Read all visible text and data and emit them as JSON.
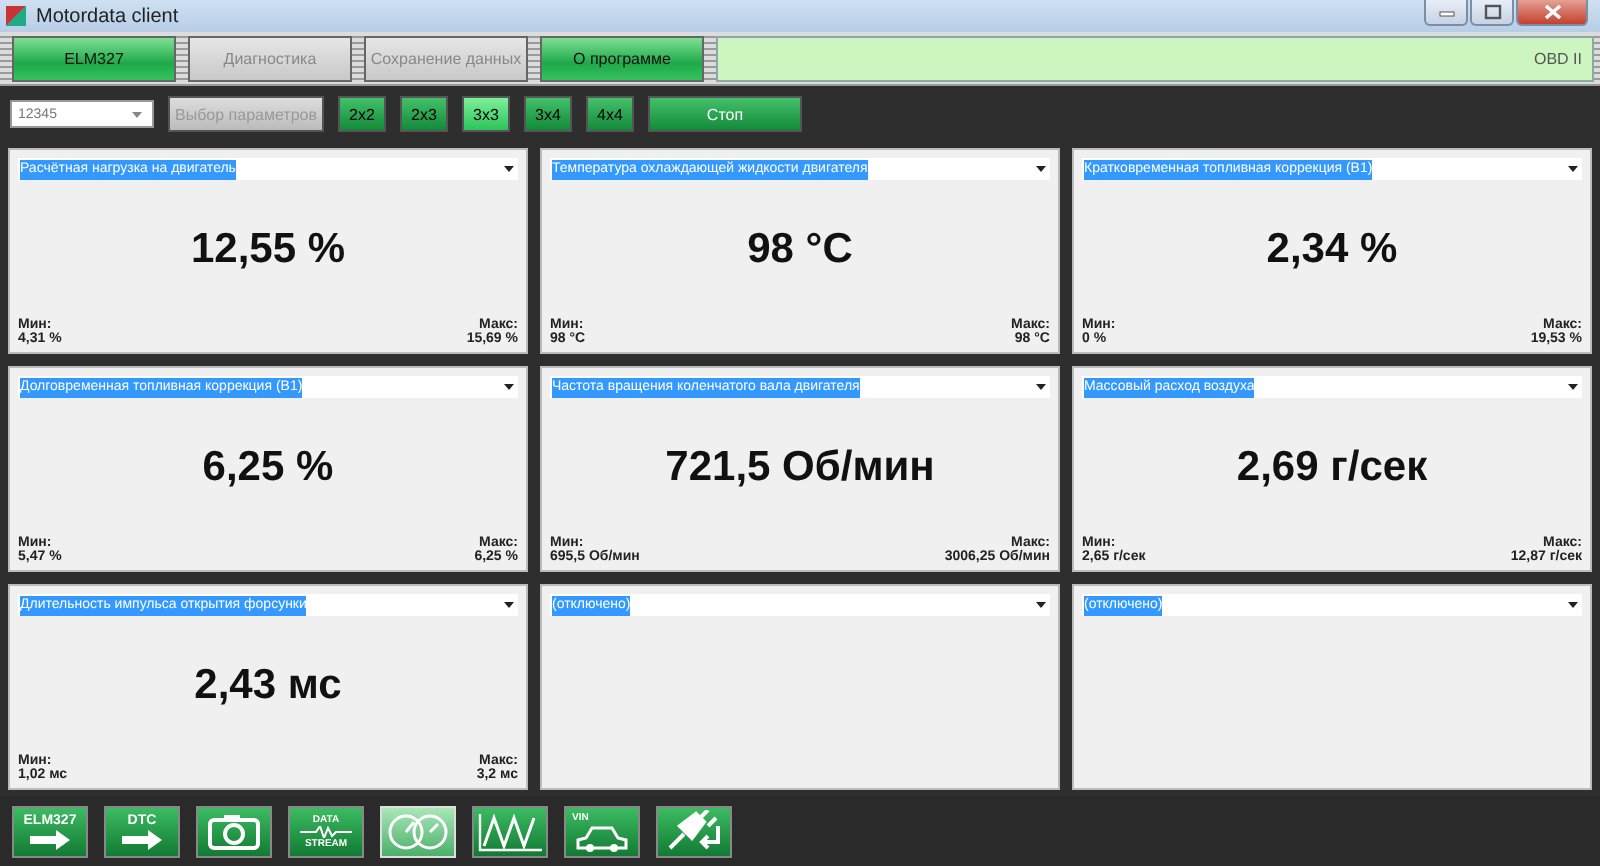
{
  "window": {
    "title": "Motordata client"
  },
  "tabs": [
    {
      "label": "ELM327",
      "disabled": false
    },
    {
      "label": "Диагностика",
      "disabled": true
    },
    {
      "label": "Сохранение данных",
      "disabled": true
    },
    {
      "label": "О программе",
      "disabled": false
    }
  ],
  "protocol": "OBD II",
  "toolbar": {
    "device": "12345",
    "params_button": {
      "label": "Выбор параметров",
      "disabled": true
    },
    "layouts": [
      {
        "label": "2x2",
        "selected": false
      },
      {
        "label": "2x3",
        "selected": false
      },
      {
        "label": "3x3",
        "selected": true
      },
      {
        "label": "3x4",
        "selected": false
      },
      {
        "label": "4x4",
        "selected": false
      }
    ],
    "stop_button": "Стоп"
  },
  "panels": [
    {
      "parameter": "Расчётная нагрузка на двигатель",
      "value": "12,55 %",
      "min_label": "Мин:",
      "min": "4,31 %",
      "max_label": "Макс:",
      "max": "15,69 %"
    },
    {
      "parameter": "Температура охлаждающей жидкости двигателя",
      "value": "98 °C",
      "min_label": "Мин:",
      "min": "98 °C",
      "max_label": "Макс:",
      "max": "98 °C"
    },
    {
      "parameter": "Кратковременная топливная коррекция (B1)",
      "value": "2,34 %",
      "min_label": "Мин:",
      "min": "0 %",
      "max_label": "Макс:",
      "max": "19,53 %"
    },
    {
      "parameter": "Долговременная топливная коррекция (B1)",
      "value": "6,25 %",
      "min_label": "Мин:",
      "min": "5,47 %",
      "max_label": "Макс:",
      "max": "6,25 %"
    },
    {
      "parameter": "Частота вращения коленчатого вала двигателя",
      "value": "721,5 Об/мин",
      "min_label": "Мин:",
      "min": "695,5 Об/мин",
      "max_label": "Макс:",
      "max": "3006,25 Об/мин"
    },
    {
      "parameter": "Массовый расход воздуха",
      "value": "2,69 г/сек",
      "min_label": "Мин:",
      "min": "2,65 г/сек",
      "max_label": "Макс:",
      "max": "12,87 г/сек"
    },
    {
      "parameter": "Длительность импульса открытия форсунки",
      "value": "2,43 мс",
      "min_label": "Мин:",
      "min": "1,02 мс",
      "max_label": "Макс:",
      "max": "3,2 мс"
    },
    {
      "parameter": "(отключено)"
    },
    {
      "parameter": "(отключено)"
    }
  ],
  "bottom_tools": [
    {
      "kind": "elm",
      "label": "ELM327",
      "selected": false
    },
    {
      "kind": "dtc",
      "label": "DTC",
      "selected": false
    },
    {
      "kind": "camera",
      "selected": false
    },
    {
      "kind": "stream",
      "label": "DATA",
      "label2": "STREAM",
      "selected": false
    },
    {
      "kind": "gauges",
      "selected": true
    },
    {
      "kind": "wave",
      "selected": false
    },
    {
      "kind": "vin",
      "label": "VIN",
      "selected": false
    },
    {
      "kind": "plug",
      "selected": false
    }
  ]
}
